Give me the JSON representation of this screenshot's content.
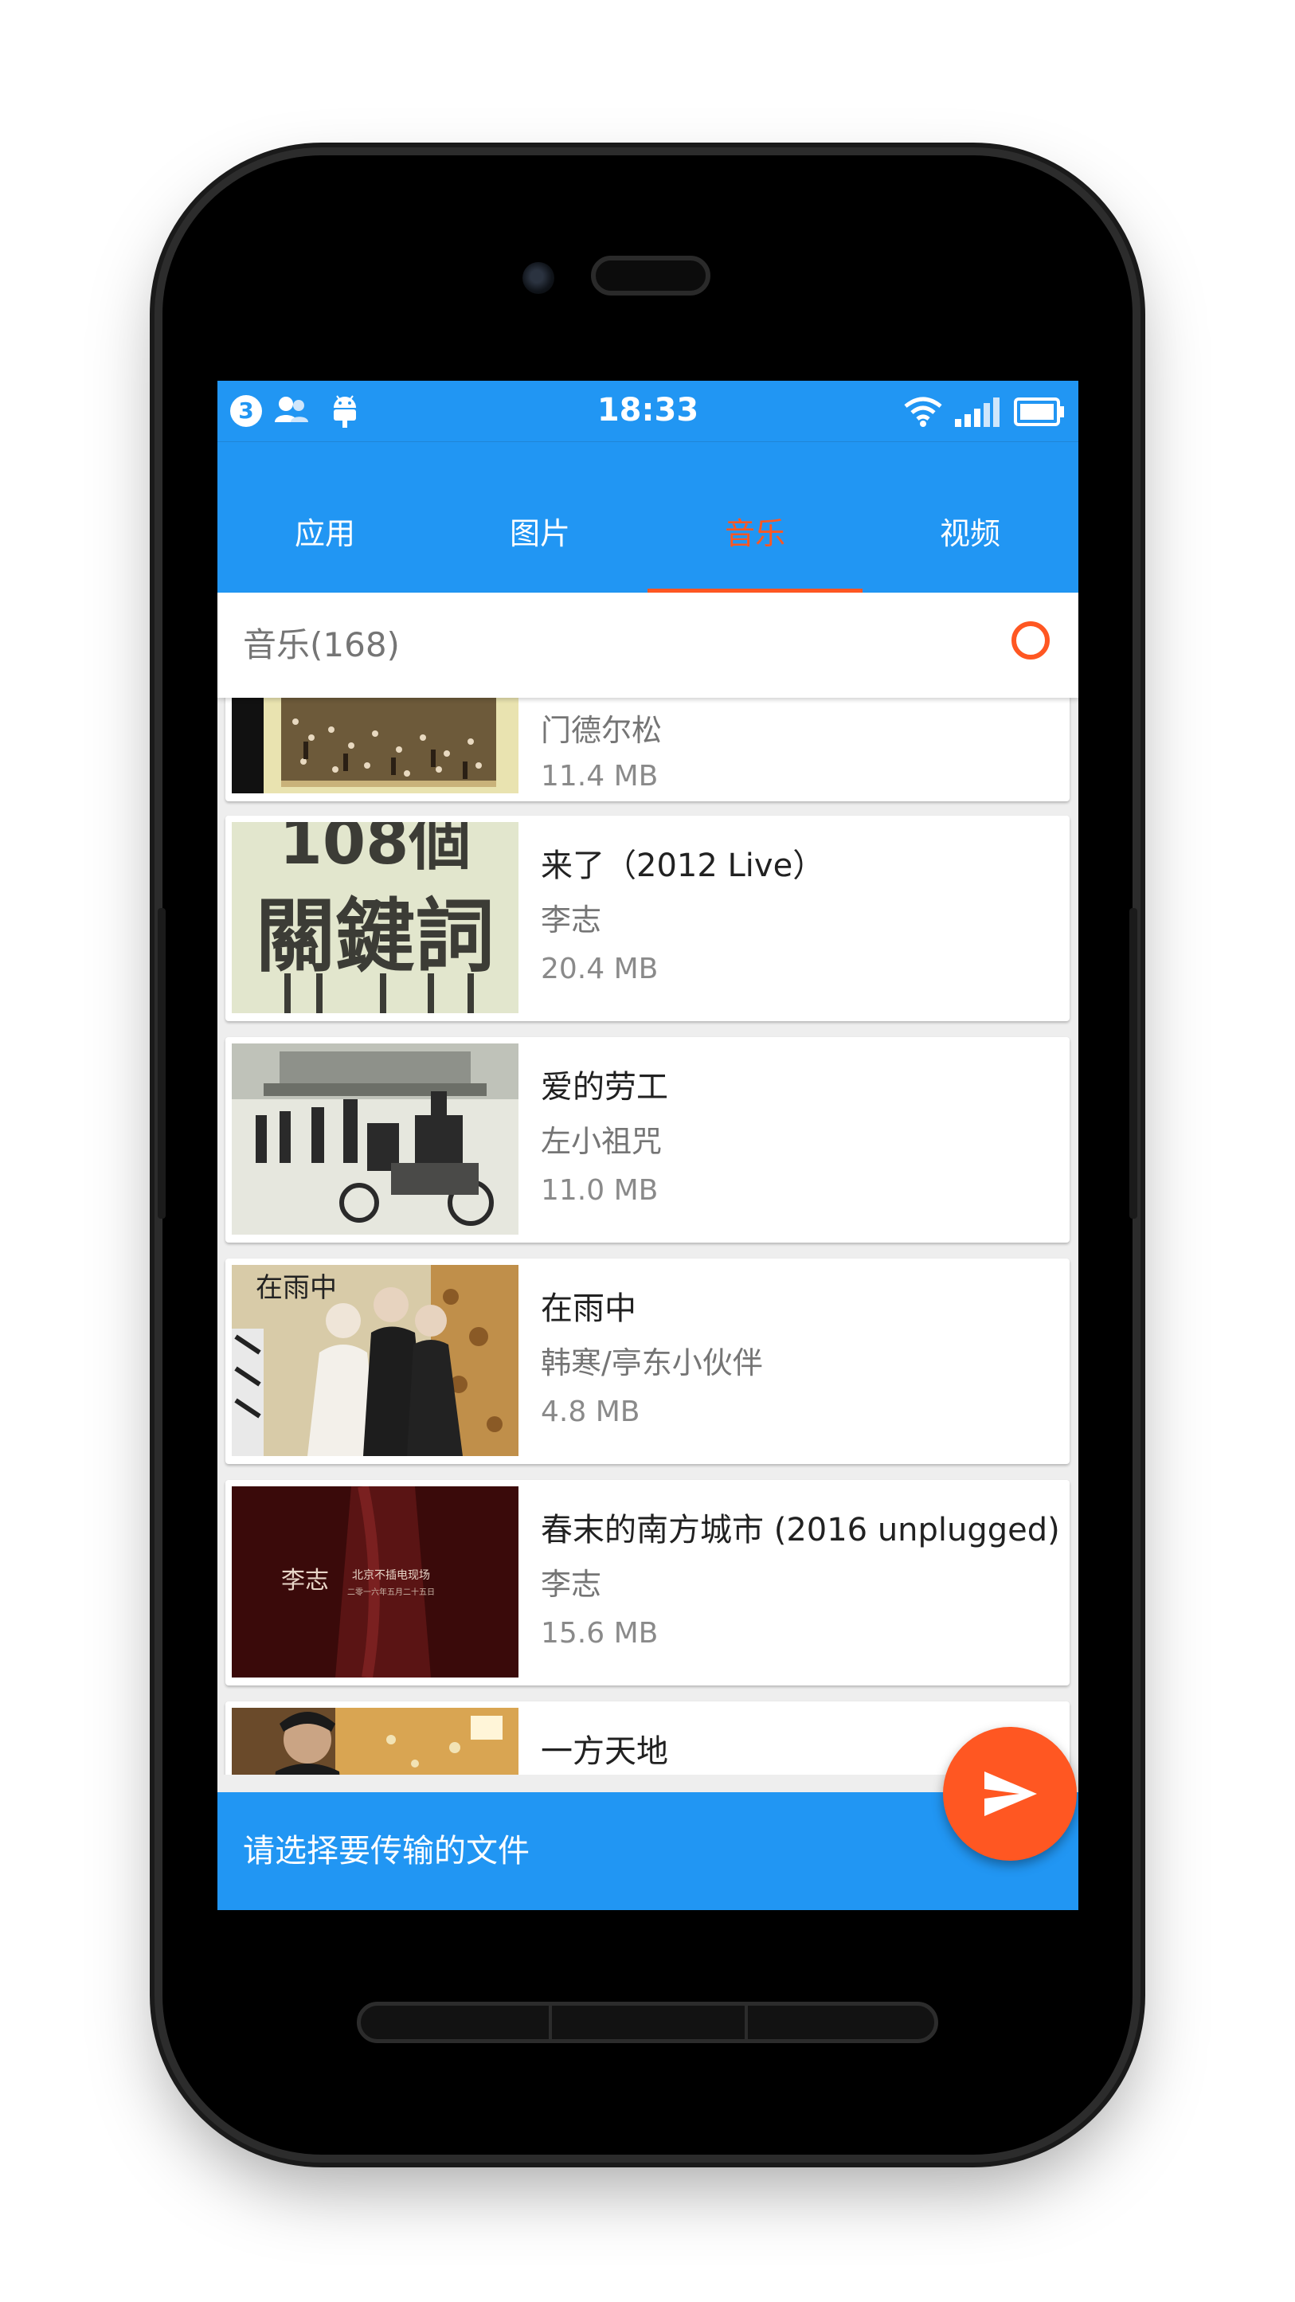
{
  "status_bar": {
    "time": "18:33",
    "notification_count": "3",
    "icons": [
      "notification-count-badge",
      "contacts-icon",
      "android-icon",
      "wifi-icon",
      "signal-icon",
      "battery-icon"
    ]
  },
  "tabs": [
    {
      "label": "应用",
      "active": false
    },
    {
      "label": "图片",
      "active": false
    },
    {
      "label": "音乐",
      "active": true
    },
    {
      "label": "视频",
      "active": false
    }
  ],
  "section": {
    "title": "音乐(168)",
    "select_icon": "select-all-circle-icon"
  },
  "songs": [
    {
      "title": "",
      "artist": "门德尔松",
      "size": "11.4 MB",
      "cover": "orchestra-photo"
    },
    {
      "title": "来了（2012 Live）",
      "artist": "李志",
      "size": "20.4 MB",
      "cover": "calligraphy-album-art"
    },
    {
      "title": "爱的劳工",
      "artist": "左小祖咒",
      "size": "11.0 MB",
      "cover": "black-white-street-photo"
    },
    {
      "title": "在雨中",
      "artist": "韩寒/亭东小伙伴",
      "size": "4.8 MB",
      "cover": "couple-poster"
    },
    {
      "title": "春末的南方城市 (2016 unplugged)",
      "artist": "李志",
      "size": "15.6 MB",
      "cover": "red-stage-photo"
    },
    {
      "title": "一方天地",
      "artist": "",
      "size": "",
      "cover": "portrait-with-gold-art"
    }
  ],
  "cover_texts": {
    "calligraphy_top": "108個",
    "calligraphy_main": "關鍵詞",
    "red_cover_name": "李志",
    "red_cover_line1": "北京不插电现场",
    "red_cover_line2": "二零一六年五月二十五日",
    "couple_cover_title": "在雨中"
  },
  "bottom_bar": {
    "prompt": "请选择要传输的文件",
    "send_icon": "send-icon"
  },
  "colors": {
    "primary": "#2196f3",
    "accent": "#ff5722",
    "background": "#eeeeee"
  }
}
